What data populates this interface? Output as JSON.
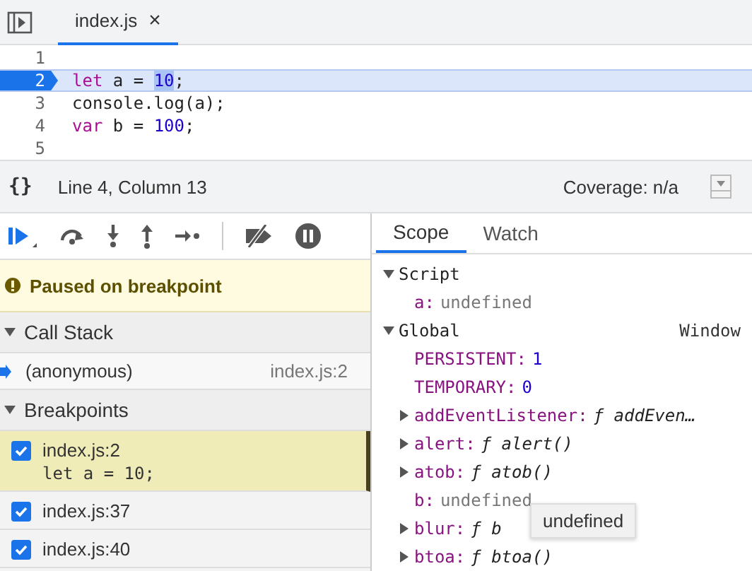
{
  "editor_tab": {
    "label": "index.js",
    "close": "×",
    "selected": true
  },
  "code_lines": [
    {
      "number": "1",
      "current": false
    },
    {
      "number": "2",
      "current": true,
      "tokens": [
        {
          "t": "let",
          "kind": "keyword"
        },
        {
          "t": " a = ",
          "kind": "plain"
        },
        {
          "t": "10",
          "kind": "selection"
        },
        {
          "t": ";",
          "kind": "plain"
        }
      ]
    },
    {
      "number": "3",
      "current": false,
      "tokens": [
        {
          "t": "console.log(a);",
          "kind": "plain"
        }
      ]
    },
    {
      "number": "4",
      "current": false,
      "tokens": [
        {
          "t": "var",
          "kind": "keyword"
        },
        {
          "t": " b = ",
          "kind": "plain"
        },
        {
          "t": "100",
          "kind": "number"
        },
        {
          "t": ";",
          "kind": "plain"
        }
      ]
    },
    {
      "number": "5",
      "current": false
    }
  ],
  "status_bar": {
    "braces": "{}",
    "position": "Line 4, Column 13",
    "coverage": "Coverage: n/a"
  },
  "paused_message": "Paused on breakpoint",
  "call_stack": {
    "title": "Call Stack",
    "expanded": true,
    "frames": [
      {
        "name": "(anonymous)",
        "location": "index.js:2",
        "current": true
      }
    ]
  },
  "breakpoints": {
    "title": "Breakpoints",
    "expanded": true,
    "items": [
      {
        "location": "index.js:2",
        "code": "let a = 10;",
        "checked": true,
        "selected": true
      },
      {
        "location": "index.js:37",
        "checked": true,
        "selected": false
      },
      {
        "location": "index.js:40",
        "checked": true,
        "selected": false
      }
    ]
  },
  "side_tabs": [
    {
      "label": "Scope",
      "selected": true
    },
    {
      "label": "Watch",
      "selected": false
    }
  ],
  "scopes": [
    {
      "title": "Script",
      "expanded": true,
      "entries": [
        {
          "name": "a:",
          "value": "undefined",
          "kind": "undefined",
          "expandable": false
        }
      ]
    },
    {
      "title": "Global",
      "value": "Window",
      "expanded": true,
      "entries": [
        {
          "name": "PERSISTENT:",
          "value": "1",
          "kind": "number",
          "expandable": false
        },
        {
          "name": "TEMPORARY:",
          "value": "0",
          "kind": "number",
          "expandable": false
        },
        {
          "name": "addEventListener:",
          "value": "ƒ addEven…",
          "kind": "function",
          "expandable": true
        },
        {
          "name": "alert:",
          "value": "ƒ alert()",
          "kind": "function",
          "expandable": true
        },
        {
          "name": "atob:",
          "value": "ƒ atob()",
          "kind": "function",
          "expandable": true
        },
        {
          "name": "b:",
          "value": "undefined",
          "kind": "undefined",
          "expandable": false
        },
        {
          "name": "blur:",
          "value": "ƒ b",
          "kind": "function",
          "expandable": true
        },
        {
          "name": "btoa:",
          "value": "ƒ btoa()",
          "kind": "function",
          "expandable": true
        }
      ]
    }
  ],
  "tooltip": "undefined"
}
